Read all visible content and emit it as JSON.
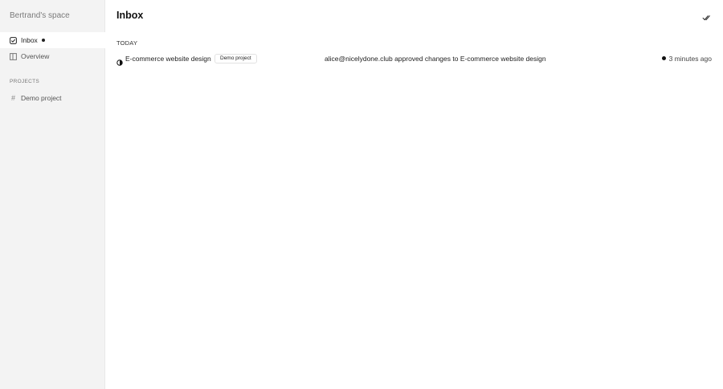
{
  "sidebar": {
    "workspace_name": "Bertrand's space",
    "items": [
      {
        "label": "Inbox",
        "icon": "check-square-icon",
        "active": true,
        "unread": true
      },
      {
        "label": "Overview",
        "icon": "board-icon",
        "active": false
      }
    ],
    "projects_heading": "PROJECTS",
    "projects": [
      {
        "label": "Demo project",
        "icon": "#"
      }
    ]
  },
  "main": {
    "title": "Inbox",
    "mark_all_read_icon": "double-check-icon",
    "groups": [
      {
        "label": "TODAY",
        "notifications": [
          {
            "task": "E-commerce website design",
            "status_icon": "half-circle-icon",
            "project_tag": "Demo project",
            "message": "alice@nicelydone.club approved changes to E-commerce website design",
            "time": "3 minutes ago",
            "unread": true
          }
        ]
      }
    ]
  },
  "colors": {
    "sidebar_bg": "#f3f3f3",
    "active_item_bg": "#ffffff",
    "text": "#222222",
    "muted_text": "#7a7a7a"
  }
}
